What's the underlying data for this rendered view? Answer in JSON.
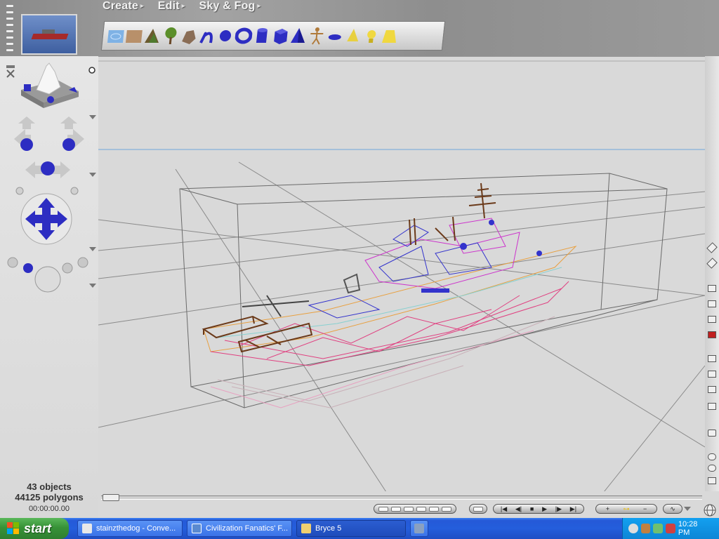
{
  "menu": {
    "items": [
      {
        "label": "Create",
        "arrow": "▸"
      },
      {
        "label": "Edit",
        "arrow": "▸"
      },
      {
        "label": "Sky & Fog",
        "arrow": "▸"
      }
    ]
  },
  "palette": {
    "icons": [
      "water-plane-icon",
      "ground-plane-icon",
      "terrain-icon",
      "tree-icon",
      "rock-icon",
      "symmetrical-lattice-icon",
      "torus-icon",
      "cylinder-icon",
      "cube-icon",
      "pyramid-icon",
      "human-figure-icon",
      "disc-icon",
      "cone-icon",
      "light-icon"
    ]
  },
  "status": {
    "objects": "43 objects",
    "polygons": "44125 polygons",
    "time": "00:00:00.00"
  },
  "colors": {
    "viewport_bg": "#d9d9d9",
    "horizon_line": "#6fa8dc",
    "ship_wire_blue": "#3333cc",
    "ship_wire_magenta": "#cc33cc",
    "ship_wire_orange": "#e8a040",
    "ship_wire_pink": "#e04080",
    "ship_wire_brown": "#6b3a1a",
    "ship_wire_cyan": "#88d0d0"
  },
  "taskbar": {
    "start_label": "start",
    "tasks": [
      {
        "label": "stainzthedog - Conve...",
        "icon": "message-icon"
      },
      {
        "label": "Civilization Fanatics' F...",
        "icon": "browser-icon"
      },
      {
        "label": "Bryce 5",
        "icon": "folder-icon"
      }
    ],
    "clock": "10:28 PM"
  }
}
